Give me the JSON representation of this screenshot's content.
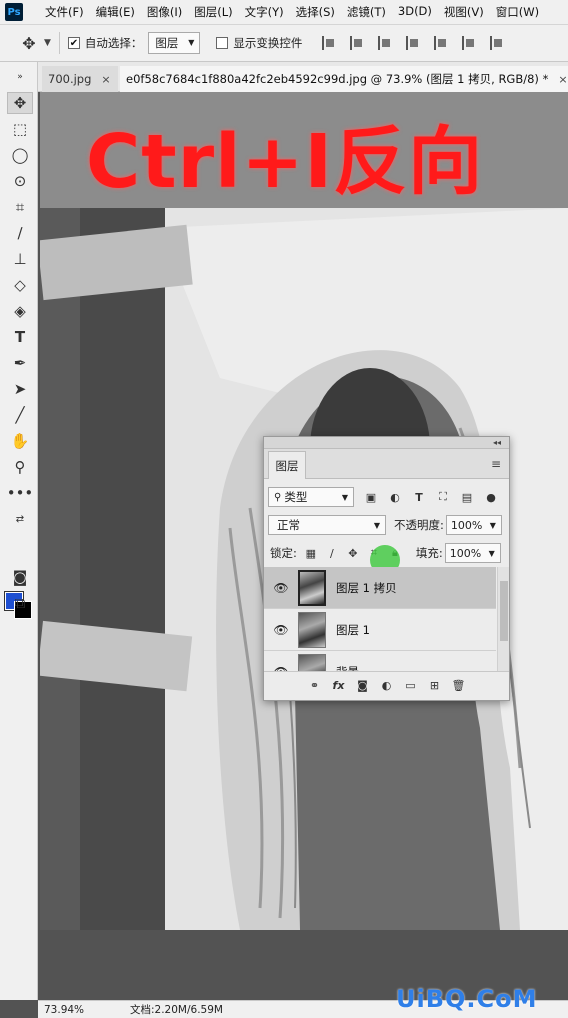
{
  "app": {
    "logo": "Ps"
  },
  "menu": [
    "文件(F)",
    "编辑(E)",
    "图像(I)",
    "图层(L)",
    "文字(Y)",
    "选择(S)",
    "滤镜(T)",
    "3D(D)",
    "视图(V)",
    "窗口(W)"
  ],
  "options_bar": {
    "auto_select_label": "自动选择：",
    "auto_select_checked": true,
    "target_value": "图层",
    "show_transform_label": "显示变换控件",
    "show_transform_checked": false
  },
  "tabs": {
    "inactive": {
      "label": "700.jpg",
      "close": "×"
    },
    "active": {
      "label": "e0f58c7684c1f880a42fc2eb4592c99d.jpg @ 73.9% (图层 1 拷贝, RGB/8) *",
      "close": "×"
    }
  },
  "canvas": {
    "overlay_text": "Ctrl+I反向"
  },
  "colors": {
    "foreground": "#1e4fd1",
    "background": "#000000",
    "overlay_text": "#ff1a1a",
    "watermark": "#2f7fe8"
  },
  "layers_panel": {
    "collapse": "◂◂",
    "tab_label": "图层",
    "kind_value": "类型",
    "blend_mode": "正常",
    "opacity_label": "不透明度:",
    "opacity_value": "100%",
    "lock_label": "锁定:",
    "fill_label": "填充:",
    "fill_value": "100%",
    "layers": [
      {
        "name": "图层 1 拷贝",
        "visible": true,
        "selected": true
      },
      {
        "name": "图层 1",
        "visible": true,
        "selected": false
      },
      {
        "name": "背景",
        "visible": true,
        "selected": false
      }
    ]
  },
  "status": {
    "zoom": "73.94%",
    "doc": "文档:2.20M/6.59M"
  },
  "watermark": "UiBQ.CoM"
}
